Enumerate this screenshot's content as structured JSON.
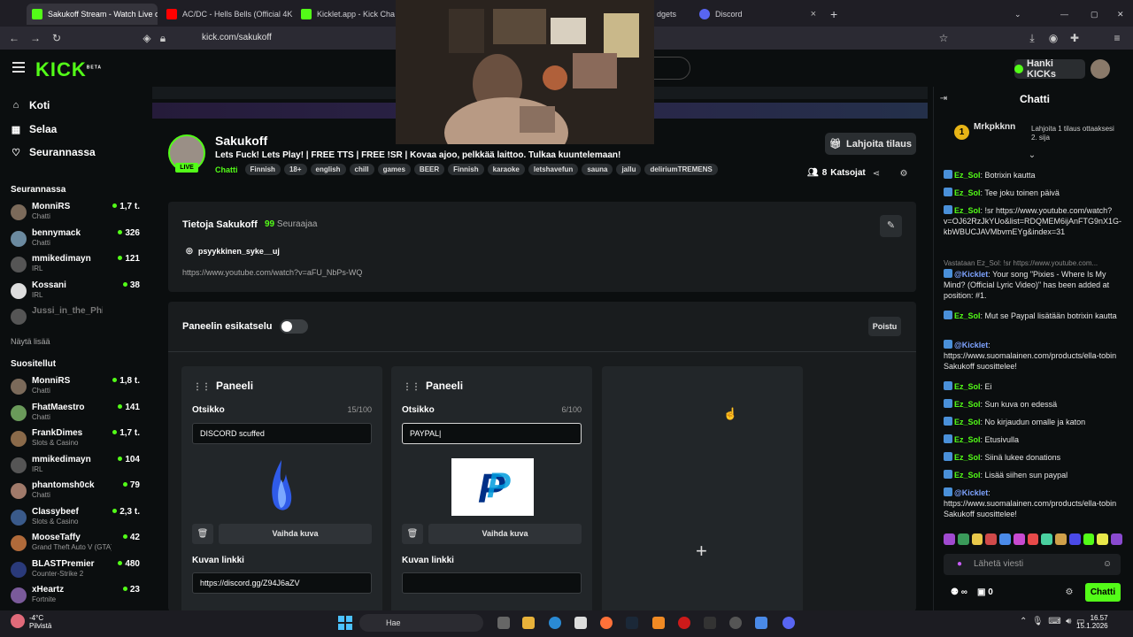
{
  "browser": {
    "tabs": [
      {
        "label": "Sakukoff Stream - Watch Live o",
        "color": "#53fc18"
      },
      {
        "label": "AC/DC - Hells Bells (Official 4K",
        "color": "#ff0000"
      },
      {
        "label": "Kicklet.app - Kick Chatbot a",
        "color": "#53fc18"
      },
      {
        "label": "dgets",
        "color": "#888888"
      },
      {
        "label": "Discord",
        "color": "#5865f2"
      }
    ],
    "url": "kick.com/sakukoff"
  },
  "kick": {
    "logo": "KICK",
    "beta": "BETA",
    "kicks_button": "Hanki KICKs"
  },
  "nav": {
    "home": "Koti",
    "browse": "Selaa",
    "following": "Seurannassa"
  },
  "sidebar": {
    "following_header": "Seurannassa",
    "following": [
      {
        "name": "MonniRS",
        "cat": "Chatti",
        "viewers": "1,7 t.",
        "color": "#7b6a5a"
      },
      {
        "name": "bennymack",
        "cat": "Chatti",
        "viewers": "326",
        "color": "#6b8aa0"
      },
      {
        "name": "mmikedimayn",
        "cat": "IRL",
        "viewers": "121",
        "color": "#555555"
      },
      {
        "name": "Kossani",
        "cat": "IRL",
        "viewers": "38",
        "color": "#dddddd"
      },
      {
        "name": "Jussi_in_the_Philippi...",
        "cat": "",
        "viewers": "",
        "color": "#555555"
      }
    ],
    "show_more": "Näytä lisää",
    "recommended_header": "Suositellut",
    "recommended": [
      {
        "name": "MonniRS",
        "cat": "Chatti",
        "viewers": "1,8 t.",
        "color": "#7b6a5a"
      },
      {
        "name": "FhatMaestro",
        "cat": "Chatti",
        "viewers": "141",
        "color": "#6a9a5a"
      },
      {
        "name": "FrankDimes",
        "cat": "Slots & Casino",
        "viewers": "1,7 t.",
        "color": "#8a6a4a"
      },
      {
        "name": "mmikedimayn",
        "cat": "IRL",
        "viewers": "104",
        "color": "#555555"
      },
      {
        "name": "phantomsh0ck",
        "cat": "Chatti",
        "viewers": "79",
        "color": "#a07a6a"
      },
      {
        "name": "Classybeef",
        "cat": "Slots & Casino",
        "viewers": "2,3 t.",
        "color": "#3a5a8a"
      },
      {
        "name": "MooseTaffy",
        "cat": "Grand Theft Auto V (GTA)",
        "viewers": "42",
        "color": "#b06a3a"
      },
      {
        "name": "BLASTPremier",
        "cat": "Counter-Strike 2",
        "viewers": "480",
        "color": "#2a3a7a"
      },
      {
        "name": "xHeartz",
        "cat": "Fortnite",
        "viewers": "23",
        "color": "#7a5a9a"
      }
    ]
  },
  "channel": {
    "name": "Sakukoff",
    "live": "LIVE",
    "title": "Lets Fuck! Lets Play! | FREE TTS | FREE !SR | Kovaa ajoo, pelkkää laittoo. Tulkaa kuuntelemaan!",
    "category": "Chatti",
    "tags": [
      "Finnish",
      "18+",
      "english",
      "chill",
      "games",
      "BEER",
      "Finnish",
      "karaoke",
      "letshavefun",
      "sauna",
      "jallu",
      "deliriumTREMENS"
    ],
    "subscribe": "Lahjoita tilaus",
    "viewers": "8",
    "viewers_label": "Katsojat"
  },
  "about": {
    "title": "Tietoja Sakukoff",
    "followers": "99",
    "followers_label": "Seuraajaa",
    "instagram": "psyykkinen_syke__uj",
    "link": "https://www.youtube.com/watch?v=aFU_NbPs-WQ"
  },
  "editor": {
    "preview_label": "Paneelin esikatselu",
    "delete": "Poistu"
  },
  "panels": [
    {
      "header": "Paneeli",
      "title_label": "Otsikko",
      "count": "15/100",
      "title_value": "DISCORD scuffed",
      "change_image": "Vaihda kuva",
      "link_label": "Kuvan linkki",
      "link_value": "https://discord.gg/Z94J6aZV"
    },
    {
      "header": "Paneeli",
      "title_label": "Otsikko",
      "count": "6/100",
      "title_value": "PAYPAL",
      "change_image": "Vaihda kuva",
      "link_label": "Kuvan linkki",
      "link_value": ""
    }
  ],
  "chat": {
    "title": "Chatti",
    "gift_user": "Mrkpkknn",
    "gift_count": "1",
    "gift_text": "Lahjoita 1 tilaus ottaaksesi 2. sija",
    "input_placeholder": "Lähetä viesti",
    "send": "Chatti",
    "bottom_count": "0",
    "messages": [
      {
        "user": "Ez_Sol",
        "text": "Botrixin kautta",
        "bot": false
      },
      {
        "user": "Ez_Sol",
        "text": "Tee joku toinen päivä",
        "bot": false
      },
      {
        "user": "Ez_Sol",
        "text": "!sr https://www.youtube.com/watch?v=OJ62RzJkYUo&list=RDQMEM6ijAnFTG9nX1G-kbWBUCJAVMbvmEYg&index=31",
        "bot": false
      },
      {
        "user": "",
        "text": "Vastataan Ez_Sol: !sr https://www.youtube.com...",
        "bot": false
      },
      {
        "user": "@Kicklet",
        "text": "Your song \"Pixies - Where Is My Mind? (Official Lyric Video)\" has been added at position: #1.",
        "bot": true
      },
      {
        "user": "Ez_Sol",
        "text": "Mut se Paypal lisätään botrixin kautta",
        "bot": false
      },
      {
        "user": "@Kicklet",
        "text": "https://www.suomalainen.com/products/ella-tobin Sakukoff suosittelee!",
        "bot": true
      },
      {
        "user": "Ez_Sol",
        "text": "Ei",
        "bot": false
      },
      {
        "user": "Ez_Sol",
        "text": "Sun kuva on edessä",
        "bot": false
      },
      {
        "user": "Ez_Sol",
        "text": "No kirjaudun omalle ja katon",
        "bot": false
      },
      {
        "user": "Ez_Sol",
        "text": "Etusivulla",
        "bot": false
      },
      {
        "user": "Ez_Sol",
        "text": "Siinä lukee donations",
        "bot": false
      },
      {
        "user": "Ez_Sol",
        "text": "Lisää siihen sun paypal",
        "bot": false
      },
      {
        "user": "@Kicklet",
        "text": "https://www.suomalainen.com/products/ella-tobin Sakukoff suosittelee!",
        "bot": true
      }
    ]
  },
  "taskbar": {
    "temp": "-4°C",
    "weather": "Pilvistä",
    "search": "Hae",
    "time": "16.57",
    "date": "15.1.2026"
  }
}
